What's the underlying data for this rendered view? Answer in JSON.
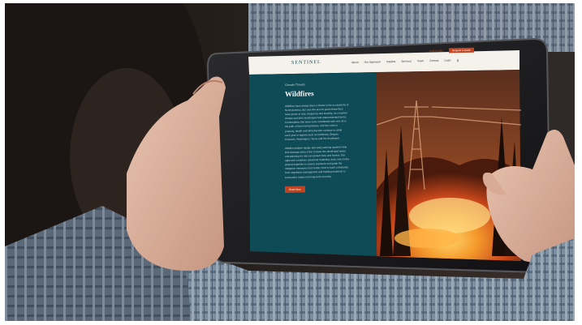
{
  "nav": {
    "logo": "SENTINEL",
    "links": [
      "About",
      "Our Approach",
      "Insights",
      "Services",
      "Team",
      "Contact",
      "Login"
    ],
    "top_buttons": [
      "SUBSCRIBE",
      "Request a Quote"
    ]
  },
  "hero": {
    "kicker": "Climate Threats",
    "title": "Wildfires",
    "para1": [
      "Wildfires have always been a fixture in the ecosystems of",
      "North America. But over the last 20 years these fires",
      "have grown in size, frequency and severity, as a warmer",
      "climate and drier landscapes fuel unprecedented burns.",
      "Communities that were once considered safe now sit in",
      "the path of fast-moving flames, and the costs to",
      "property, health and infrastructure continue to climb",
      "each year in regions such as California, Oregon,",
      "Colorado, Washington, Texas and the Southwest."
    ],
    "para2": [
      "Wildfire-resilient design and early warning systems help",
      "limit damage when a fire crosses into developed areas,",
      "and planning for risk can protect lives and homes. Our",
      "approach combines advanced modeling, data, and on-the-",
      "ground expertise to assess exposure and guide the",
      "mitigation measures that matter most to each community,",
      "from vegetation management and building materials to",
      "evacuation routes and long-term recovery."
    ],
    "cta": "Read More"
  },
  "colors": {
    "panel": "#0f4a57",
    "accent": "#c2431f",
    "fire": "#f07a1a"
  }
}
